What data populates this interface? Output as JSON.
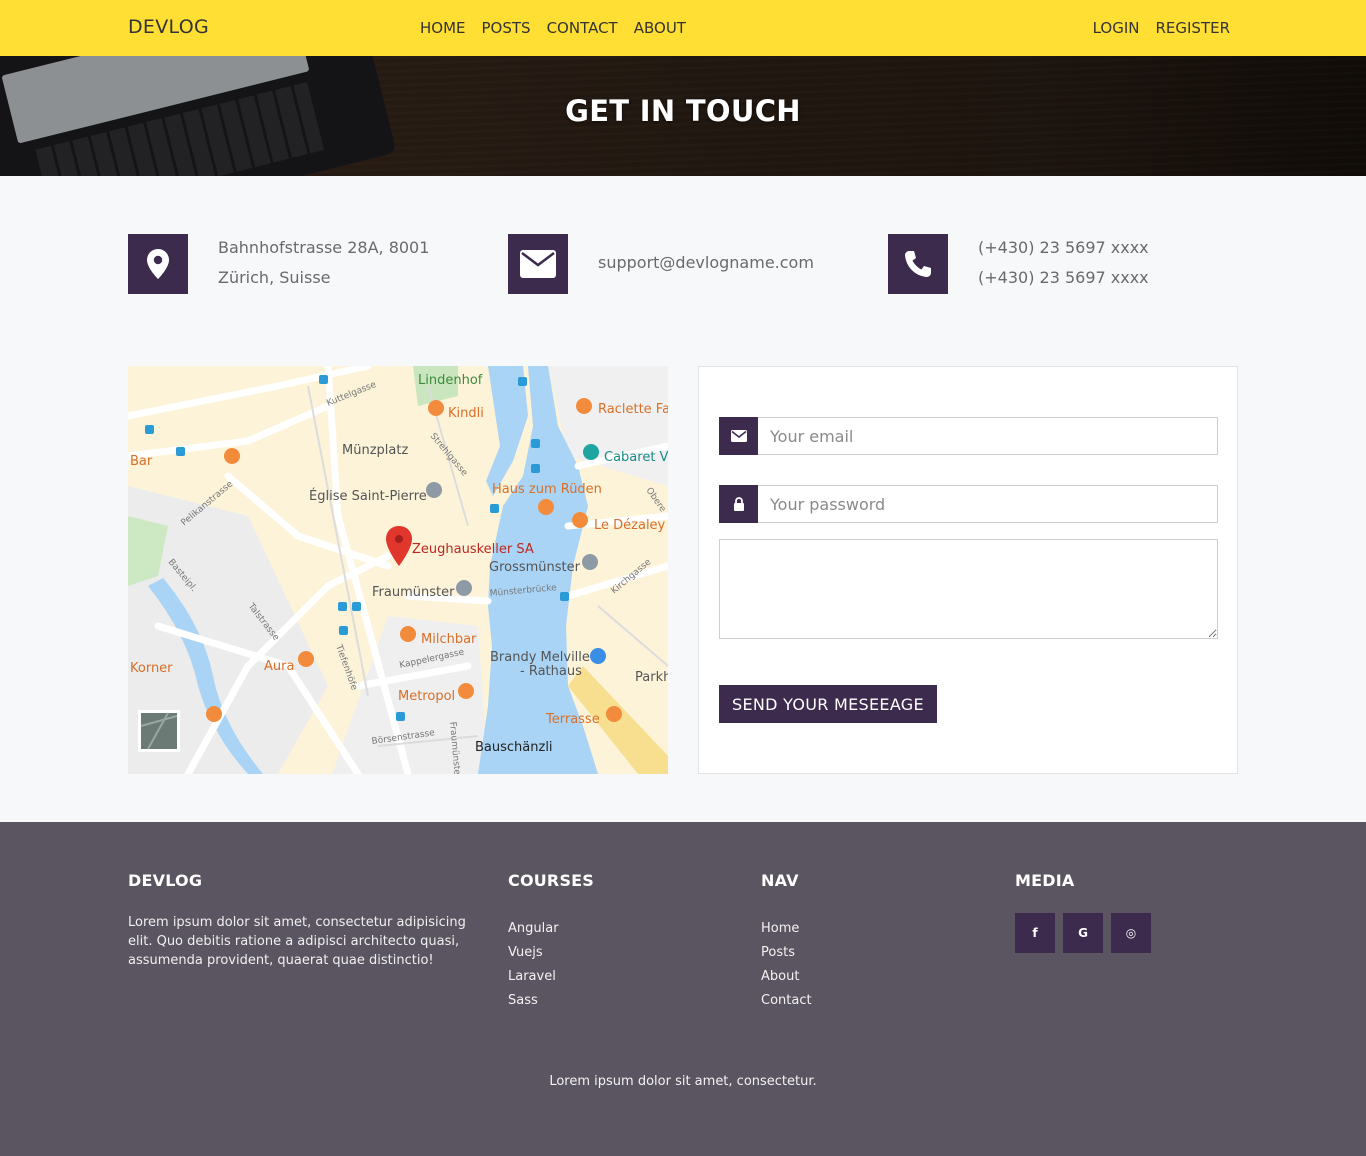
{
  "nav": {
    "brand": "DEVLOG",
    "center": [
      "HOME",
      "POSTS",
      "CONTACT",
      "ABOUT"
    ],
    "right": [
      "LOGIN",
      "REGISTER"
    ],
    "bg_color": "#ffdf34"
  },
  "hero": {
    "title": "GET IN TOUCH"
  },
  "info": {
    "address": {
      "icon": "map-marker-icon",
      "line1": "Bahnhofstrasse 28A, 8001",
      "line2": "Zürich, Suisse"
    },
    "email": {
      "icon": "envelope-icon",
      "text": "support@devlogname.com"
    },
    "phone": {
      "icon": "phone-icon",
      "line1": "(+430) 23 5697 xxxx",
      "line2": "(+430) 23 5697 xxxx"
    }
  },
  "map": {
    "marker_label": "Zeughauskeller SA",
    "places": [
      "Lindenhof",
      "Kindli",
      "Raclette Fa",
      "Münzplatz",
      "Cabaret Vo",
      "Bar",
      "Église Saint-Pierre",
      "Haus zum Rüden",
      "Le Dézaley",
      "Grossmünster",
      "Fraumünster",
      "Milchbar",
      "Brandy Melville - Rathaus",
      "Aura",
      "Korner",
      "Metropol",
      "Terrasse",
      "Bauschänzli",
      "Parkh"
    ],
    "streets": [
      "Kuttelgasse",
      "Strehlgasse",
      "Pelikanstrasse",
      "Basteipl.",
      "Talstrasse",
      "Tiefenhöfe",
      "Kappelergasse",
      "Münsterbrücke",
      "Kirchgasse",
      "Börsenstrasse",
      "Fraumünster",
      "Obere"
    ]
  },
  "form": {
    "email_placeholder": "Your email",
    "password_placeholder": "Your password",
    "send_label": "SEND YOUR MESEEAGE"
  },
  "footer": {
    "brand_title": "DEVLOG",
    "about": "Lorem ipsum dolor sit amet, consectetur adipisicing elit. Quo debitis ratione a adipisci architecto quasi, assumenda provident, quaerat quae distinctio!",
    "courses_title": "COURSES",
    "courses": [
      "Angular",
      "Vuejs",
      "Laravel",
      "Sass"
    ],
    "nav_title": "NAV",
    "nav": [
      "Home",
      "Posts",
      "About",
      "Contact"
    ],
    "media_title": "MEDIA",
    "media": [
      {
        "icon": "facebook-icon",
        "glyph": "f"
      },
      {
        "icon": "google-icon",
        "glyph": "G"
      },
      {
        "icon": "instagram-icon",
        "glyph": "◎"
      }
    ],
    "copyright": "Lorem ipsum dolor sit amet, consectetur."
  },
  "colors": {
    "accent": "#3c2b4d",
    "footer": "#5a5560",
    "nav": "#ffdf34"
  }
}
